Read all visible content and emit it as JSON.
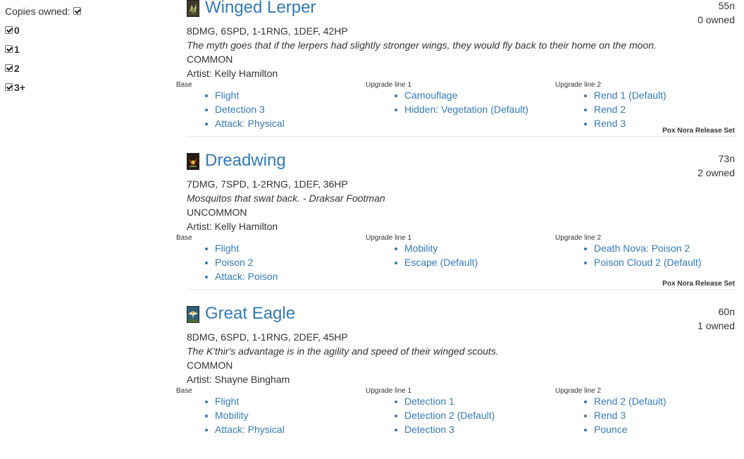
{
  "sidebar": {
    "copies_title": "Copies owned:",
    "options": [
      {
        "label": "0"
      },
      {
        "label": "1"
      },
      {
        "label": "2"
      },
      {
        "label": "3+"
      }
    ]
  },
  "cards": [
    {
      "name": "Winged Lerper",
      "cost": "55n",
      "owned": "0 owned",
      "stats": "8DMG, 6SPD, 1-1RNG, 1DEF, 42HP",
      "flavor": "The myth goes that if the lerpers had slightly stronger wings, they would fly back to their home on the moon.",
      "rarity": "COMMON",
      "artist": "Artist: Kelly Hamilton",
      "icon": "winged-lerper-portrait",
      "columns": [
        {
          "heading": "Base",
          "abilities": [
            "Flight",
            "Detection 3",
            "Attack: Physical"
          ]
        },
        {
          "heading": "Upgrade line 1",
          "abilities": [
            "Camouflage",
            "Hidden: Vegetation (Default)"
          ]
        },
        {
          "heading": "Upgrade line 2",
          "abilities": [
            "Rend 1 (Default)",
            "Rend 2",
            "Rend 3"
          ]
        }
      ],
      "set": "Pox Nora Release Set"
    },
    {
      "name": "Dreadwing",
      "cost": "73n",
      "owned": "2 owned",
      "stats": "7DMG, 7SPD, 1-2RNG, 1DEF, 36HP",
      "flavor": "Mosquitos that swat back. - Draksar Footman",
      "rarity": "UNCOMMON",
      "artist": "Artist: Kelly Hamilton",
      "icon": "dreadwing-portrait",
      "columns": [
        {
          "heading": "Base",
          "abilities": [
            "Flight",
            "Poison 2",
            "Attack: Poison"
          ]
        },
        {
          "heading": "Upgrade line 1",
          "abilities": [
            "Mobility",
            "Escape (Default)"
          ]
        },
        {
          "heading": "Upgrade line 2",
          "abilities": [
            "Death Nova: Poison 2",
            "Poison Cloud 2 (Default)"
          ]
        }
      ],
      "set": "Pox Nora Release Set"
    },
    {
      "name": "Great Eagle",
      "cost": "60n",
      "owned": "1 owned",
      "stats": "8DMG, 6SPD, 1-1RNG, 2DEF, 45HP",
      "flavor": "The K'thir's advantage is in the agility and speed of their winged scouts.",
      "rarity": "COMMON",
      "artist": "Artist: Shayne Bingham",
      "icon": "great-eagle-portrait",
      "columns": [
        {
          "heading": "Base",
          "abilities": [
            "Flight",
            "Mobility",
            "Attack: Physical"
          ]
        },
        {
          "heading": "Upgrade line 1",
          "abilities": [
            "Detection 1",
            "Detection 2 (Default)",
            "Detection 3"
          ]
        },
        {
          "heading": "Upgrade line 2",
          "abilities": [
            "Rend 2 (Default)",
            "Rend 3",
            "Pounce"
          ]
        }
      ],
      "set": ""
    }
  ],
  "colors": {
    "link": "#337ab7",
    "text": "#333333",
    "separator": "#e6e6e6"
  }
}
